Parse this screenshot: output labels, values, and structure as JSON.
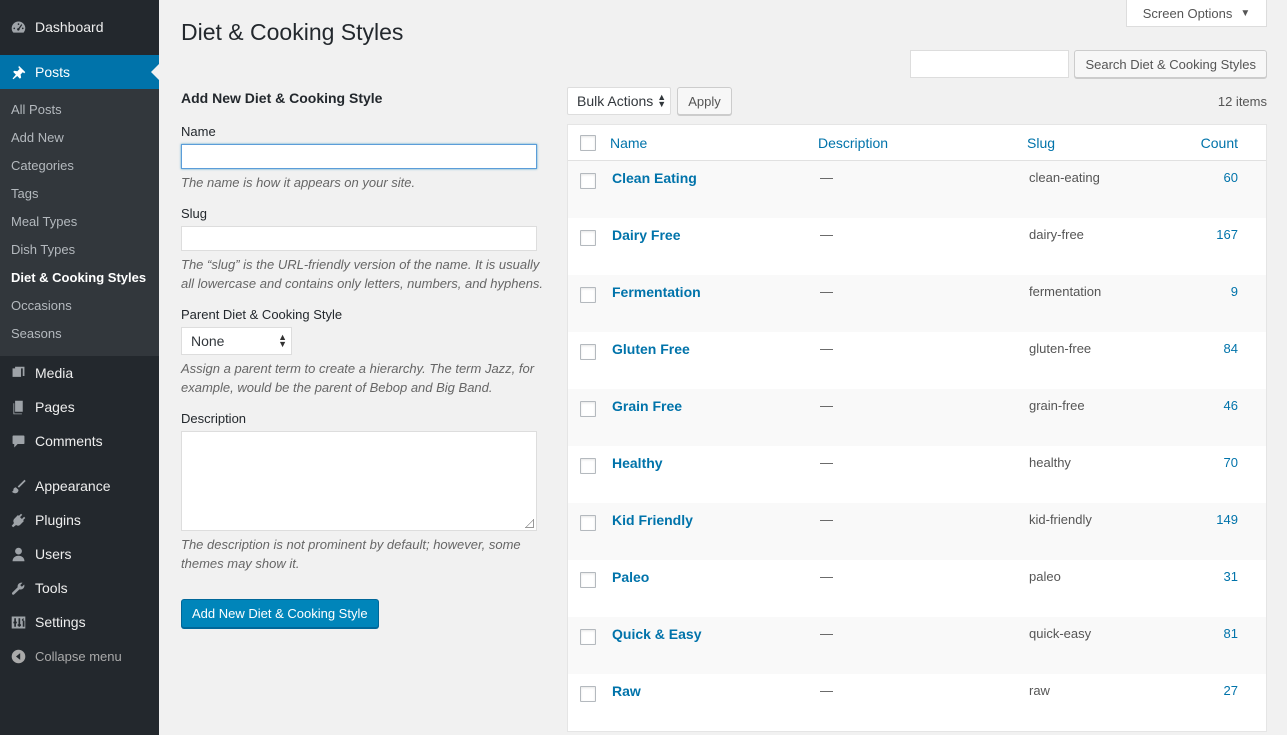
{
  "sidebar": {
    "dashboard": "Dashboard",
    "posts": "Posts",
    "submenu": [
      "All Posts",
      "Add New",
      "Categories",
      "Tags",
      "Meal Types",
      "Dish Types",
      "Diet & Cooking Styles",
      "Occasions",
      "Seasons"
    ],
    "media": "Media",
    "pages": "Pages",
    "comments": "Comments",
    "appearance": "Appearance",
    "plugins": "Plugins",
    "users": "Users",
    "tools": "Tools",
    "settings": "Settings",
    "collapse": "Collapse menu"
  },
  "header": {
    "title": "Diet & Cooking Styles",
    "screen_options": "Screen Options",
    "search_button": "Search Diet & Cooking Styles",
    "search_value": ""
  },
  "form": {
    "heading": "Add New Diet & Cooking Style",
    "name_label": "Name",
    "name_help": "The name is how it appears on your site.",
    "slug_label": "Slug",
    "slug_help": "The “slug” is the URL-friendly version of the name. It is usually all lowercase and contains only letters, numbers, and hyphens.",
    "parent_label": "Parent Diet & Cooking Style",
    "parent_value": "None",
    "parent_help": "Assign a parent term to create a hierarchy. The term Jazz, for example, would be the parent of Bebop and Big Band.",
    "description_label": "Description",
    "description_help": "The description is not prominent by default; however, some themes may show it.",
    "submit": "Add New Diet & Cooking Style"
  },
  "table": {
    "bulk_actions": "Bulk Actions",
    "apply": "Apply",
    "items_count": "12 items",
    "headers": {
      "name": "Name",
      "description": "Description",
      "slug": "Slug",
      "count": "Count"
    },
    "rows": [
      {
        "name": "Clean Eating",
        "description": "—",
        "slug": "clean-eating",
        "count": "60"
      },
      {
        "name": "Dairy Free",
        "description": "—",
        "slug": "dairy-free",
        "count": "167"
      },
      {
        "name": "Fermentation",
        "description": "—",
        "slug": "fermentation",
        "count": "9"
      },
      {
        "name": "Gluten Free",
        "description": "—",
        "slug": "gluten-free",
        "count": "84"
      },
      {
        "name": "Grain Free",
        "description": "—",
        "slug": "grain-free",
        "count": "46"
      },
      {
        "name": "Healthy",
        "description": "—",
        "slug": "healthy",
        "count": "70"
      },
      {
        "name": "Kid Friendly",
        "description": "—",
        "slug": "kid-friendly",
        "count": "149"
      },
      {
        "name": "Paleo",
        "description": "—",
        "slug": "paleo",
        "count": "31"
      },
      {
        "name": "Quick & Easy",
        "description": "—",
        "slug": "quick-easy",
        "count": "81"
      },
      {
        "name": "Raw",
        "description": "—",
        "slug": "raw",
        "count": "27"
      }
    ]
  }
}
